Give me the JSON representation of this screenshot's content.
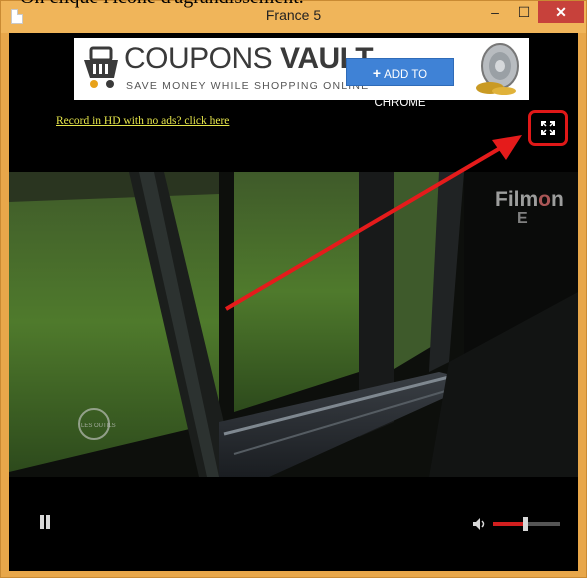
{
  "caption": "On clique l'icône d'agrandissement.",
  "window": {
    "title": "France 5",
    "min_glyph": "–",
    "max_glyph": "☐",
    "close_glyph": "✕"
  },
  "ad": {
    "brand_bold": "VAULT",
    "brand_light": "COUPONS ",
    "tagline": "SAVE MONEY WHILE SHOPPING ONLINE",
    "button_label": "ADD TO CHROME",
    "button_icon": "+"
  },
  "player": {
    "record_link": "Record in HD with no ads? click here",
    "watermark_top": "Film",
    "watermark_o": "o",
    "watermark_n": "n",
    "watermark_e": "E",
    "fullscreen_icon": "expand-icon",
    "volume_level": 0.5
  },
  "colors": {
    "accent": "#d21f1f",
    "highlight": "#e01818",
    "link": "#e6e64a",
    "title_bar": "#f0b55a"
  }
}
